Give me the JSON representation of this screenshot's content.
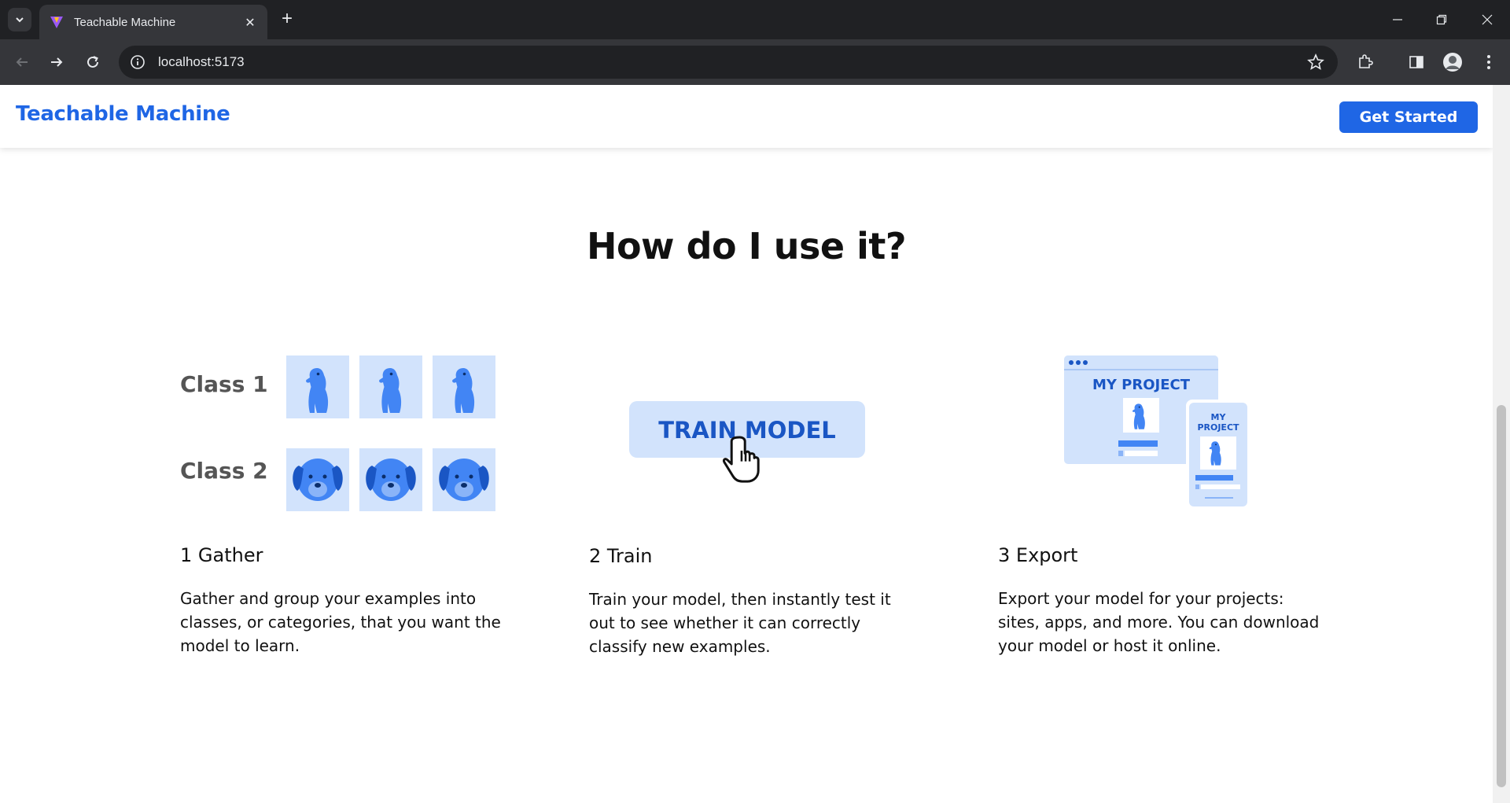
{
  "browser": {
    "tab_title": "Teachable Machine",
    "url": "localhost:5173"
  },
  "header": {
    "brand": "Teachable Machine",
    "cta_label": "Get Started"
  },
  "section": {
    "heading": "How do I use it?"
  },
  "steps": [
    {
      "title": "1 Gather",
      "description": "Gather and group your examples into classes, or categories, that you want the model to learn.",
      "illustration_labels": [
        "Class 1",
        "Class 2"
      ]
    },
    {
      "title": "2 Train",
      "description": "Train your model, then instantly test it out to see whether it can correctly classify new examples.",
      "illustration_labels": [
        "TRAIN MODEL"
      ]
    },
    {
      "title": "3 Export",
      "description": "Export your model for your projects: sites, apps, and more. You can download your model or host it online.",
      "illustration_labels": [
        "MY PROJECT",
        "MY",
        "PROJECT"
      ]
    }
  ],
  "colors": {
    "brand_blue": "#1f66e5",
    "illustration_light": "#d2e3fc",
    "illustration_mid": "#8ab4f8",
    "illustration_dark": "#1a56c4"
  }
}
